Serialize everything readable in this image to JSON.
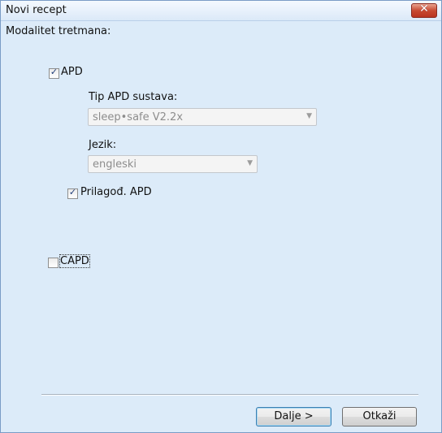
{
  "window": {
    "title": "Novi recept",
    "close_icon": "close-icon"
  },
  "form": {
    "modality_label": "Modalitet tretmana:",
    "apd": {
      "label": "APD",
      "checked": true
    },
    "apd_system_type": {
      "label": "Tip APD sustava:",
      "value": "sleep•safe V2.2x"
    },
    "language": {
      "label": "Jezik:",
      "value": "engleski"
    },
    "custom_apd": {
      "label": "Prilagođ. APD",
      "checked": true
    },
    "capd": {
      "label": "CAPD",
      "checked": false
    }
  },
  "buttons": {
    "next_label": "Dalje >",
    "cancel_label": "Otkaži"
  },
  "colors": {
    "background": "#dcebf9",
    "titlebar": "#dbe9f8",
    "close_button": "#c84a32",
    "disabled_text": "#8d8d8d"
  }
}
